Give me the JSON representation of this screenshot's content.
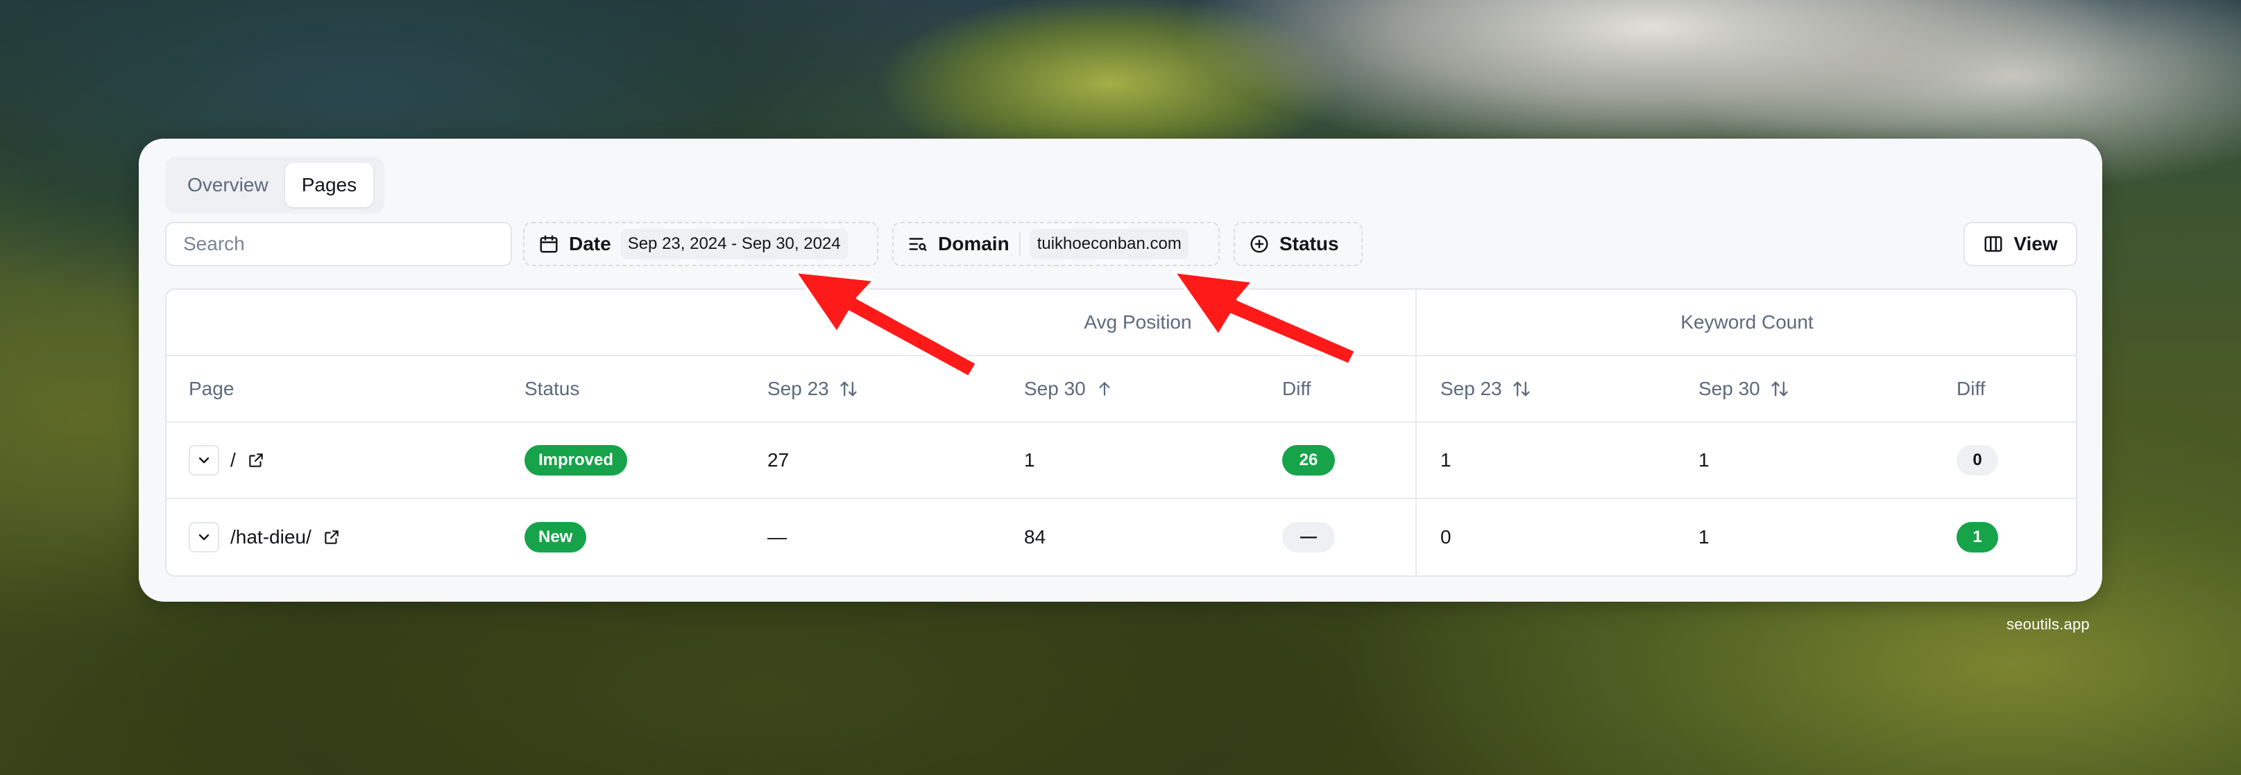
{
  "tabs": [
    {
      "label": "Overview",
      "active": false
    },
    {
      "label": "Pages",
      "active": true
    }
  ],
  "search": {
    "placeholder": "Search"
  },
  "filters": {
    "date": {
      "label": "Date",
      "value": "Sep 23, 2024 - Sep 30, 2024"
    },
    "domain": {
      "label": "Domain",
      "value": "tuikhoeconban.com"
    },
    "status": {
      "label": "Status"
    }
  },
  "view_button": {
    "label": "View"
  },
  "table": {
    "groups": {
      "avg_position": "Avg Position",
      "keyword_count": "Keyword Count"
    },
    "headers": {
      "page": "Page",
      "status": "Status",
      "pos_sep23": "Sep 23",
      "pos_sep30": "Sep 30",
      "pos_diff": "Diff",
      "kw_sep23": "Sep 23",
      "kw_sep30": "Sep 30",
      "kw_diff": "Diff"
    },
    "rows": [
      {
        "page": "/",
        "status": "Improved",
        "pos_sep23": "27",
        "pos_sep30": "1",
        "pos_diff": "26",
        "kw_sep23": "1",
        "kw_sep30": "1",
        "kw_diff": "0"
      },
      {
        "page": "/hat-dieu/",
        "status": "New",
        "pos_sep23": "—",
        "pos_sep30": "84",
        "pos_diff": "—",
        "kw_sep23": "0",
        "kw_sep30": "1",
        "kw_diff": "1"
      }
    ]
  },
  "colors": {
    "accent_green": "#16a34a",
    "annotation_red": "#ff1a1a"
  },
  "watermark": "seoutils.app"
}
